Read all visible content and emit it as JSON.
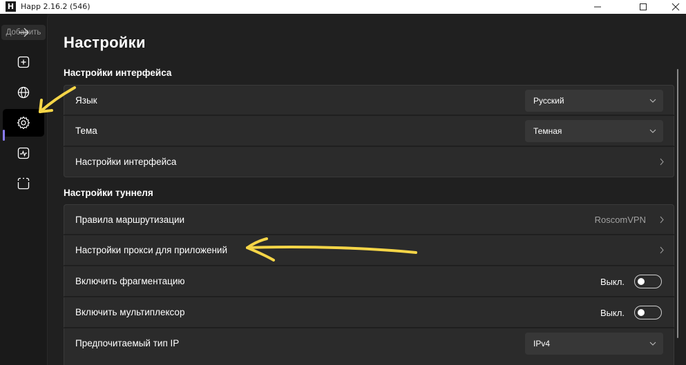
{
  "window": {
    "title": "Happ 2.16.2 (546)",
    "logo_letter": "H"
  },
  "sidebar": {
    "add_label": "Добавить",
    "items": [
      {
        "icon": "plus-square-icon"
      },
      {
        "icon": "globe-icon"
      },
      {
        "icon": "gear-icon",
        "active": true
      },
      {
        "icon": "activity-chart-icon"
      },
      {
        "icon": "scan-frame-icon"
      }
    ],
    "accent_color": "#8a7cf8"
  },
  "page": {
    "title": "Настройки"
  },
  "interface_section": {
    "title": "Настройки интерфейса",
    "language": {
      "label": "Язык",
      "value": "Русский"
    },
    "theme": {
      "label": "Тема",
      "value": "Темная"
    },
    "interface_settings": {
      "label": "Настройки интерфейса"
    }
  },
  "tunnel_section": {
    "title": "Настройки туннеля",
    "routing": {
      "label": "Правила маршрутизации",
      "value": "RoscomVPN"
    },
    "app_proxy": {
      "label": "Настройки прокси для приложений"
    },
    "fragmentation": {
      "label": "Включить фрагментацию",
      "state": "Выкл."
    },
    "multiplexer": {
      "label": "Включить мультиплексор",
      "state": "Выкл."
    },
    "ip_type": {
      "label": "Предпочитаемый тип IP",
      "value": "IPv4"
    }
  },
  "annotation_color": "#f5d547"
}
